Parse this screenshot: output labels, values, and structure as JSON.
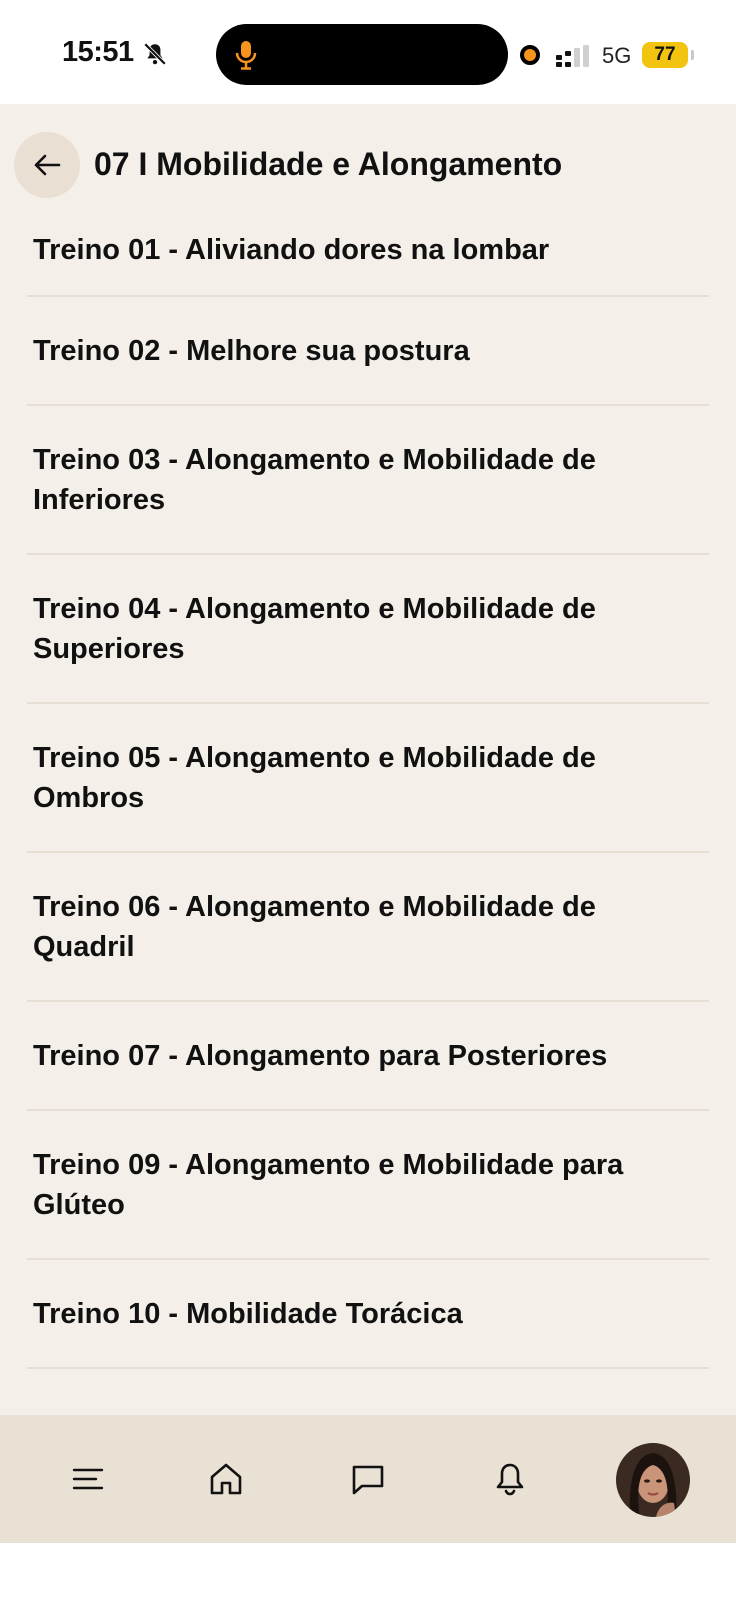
{
  "status_bar": {
    "time": "15:51",
    "network": "5G",
    "battery": "77",
    "icons": [
      "bell-off-icon",
      "microphone-icon",
      "recording-dot-icon",
      "signal-icon",
      "battery-icon"
    ]
  },
  "header": {
    "back_icon": "arrow-left-icon",
    "title": "07 I Mobilidade e Alongamento"
  },
  "workouts": [
    {
      "label": "Treino 01 - Aliviando dores na lombar"
    },
    {
      "label": "Treino 02 - Melhore sua postura"
    },
    {
      "label": "Treino 03 - Alongamento e Mobilidade de Inferiores"
    },
    {
      "label": "Treino 04 - Alongamento e Mobilidade de Superiores"
    },
    {
      "label": "Treino 05 - Alongamento e Mobilidade de Ombros"
    },
    {
      "label": "Treino 06 - Alongamento e Mobilidade de Quadril"
    },
    {
      "label": "Treino 07 - Alongamento para Posteriores"
    },
    {
      "label": "Treino 09 - Alongamento e Mobilidade para Glúteo"
    },
    {
      "label": "Treino 10 - Mobilidade Torácica"
    }
  ],
  "bottom_nav": {
    "items": [
      "menu-icon",
      "home-icon",
      "chat-icon",
      "bell-icon",
      "profile-avatar"
    ]
  },
  "colors": {
    "background": "#f4efe8",
    "nav_background": "#eae1d5",
    "divider": "#e6ded3",
    "battery": "#f2c40f",
    "mic": "#f7941d"
  }
}
